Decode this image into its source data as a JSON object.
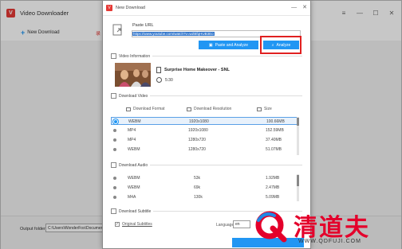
{
  "app": {
    "title": "Video Downloader",
    "new_download_label": "New Download",
    "toolbar_red_text": "录",
    "output_folder_label": "Output folder:",
    "output_folder_value": "C:\\Users\\WonderFox\\Documents\\"
  },
  "dialog": {
    "title": "New Download",
    "paste_url_label": "Paste URL",
    "url_value": "https://www.youtube.com/watch?v=wZBfqHUB3Eo",
    "paste_and_analyze_label": "Paste and Analyze",
    "analyze_label": "Analyze",
    "video_info_header": "Video Information",
    "video_title": "Surprise Home Makeover - SNL",
    "video_duration": "5:30",
    "download_video_header": "Download Video",
    "video_columns": [
      "Download Format",
      "Download Resolution",
      "Size"
    ],
    "video_rows": [
      {
        "format": "WEBM",
        "resolution": "1920x1080",
        "size": "100.66MB",
        "selected": true
      },
      {
        "format": "MP4",
        "resolution": "1920x1080",
        "size": "152.59MB",
        "selected": false
      },
      {
        "format": "MP4",
        "resolution": "1280x720",
        "size": "37.40MB",
        "selected": false
      },
      {
        "format": "WEBM",
        "resolution": "1280x720",
        "size": "51.07MB",
        "selected": false
      }
    ],
    "download_audio_header": "Download Audio",
    "audio_rows": [
      {
        "format": "WEBM",
        "bitrate": "53k",
        "size": "1.92MB"
      },
      {
        "format": "WEBM",
        "bitrate": "69k",
        "size": "2.47MB"
      },
      {
        "format": "M4A",
        "bitrate": "130k",
        "size": "5.09MB"
      }
    ],
    "download_subtitle_header": "Download Subtitle",
    "original_subtitles_label": "Original Subtitles",
    "language_label": "Language",
    "language_value": "en"
  },
  "watermark": {
    "brand_text": "清道夫",
    "url_text": "WWW.QDFUJI.COM"
  },
  "colors": {
    "accent": "#2196f3",
    "highlight_box": "#e02020",
    "watermark_red": "#e4002b"
  },
  "icons": [
    "app-logo-icon",
    "plus-icon",
    "link-icon",
    "clipboard-icon",
    "search-icon",
    "film-icon",
    "clock-icon",
    "minimize-icon",
    "maximize-icon",
    "close-icon",
    "checkmark-icon"
  ]
}
